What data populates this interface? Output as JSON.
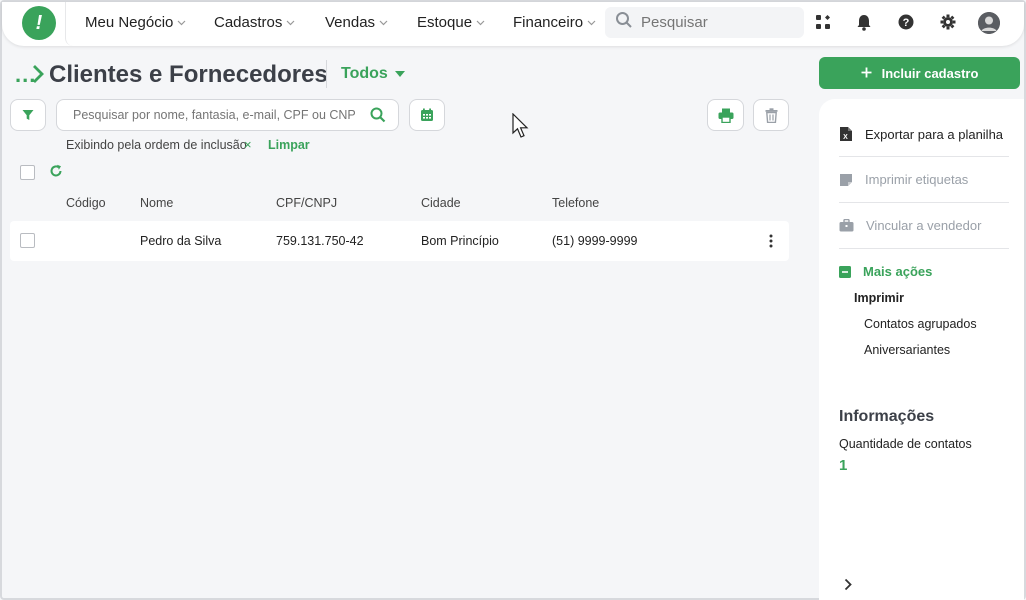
{
  "logo": {
    "glyph": "!"
  },
  "nav": [
    {
      "label": "Meu Negócio"
    },
    {
      "label": "Cadastros"
    },
    {
      "label": "Vendas"
    },
    {
      "label": "Estoque"
    },
    {
      "label": "Financeiro"
    }
  ],
  "top_search": {
    "placeholder": "Pesquisar"
  },
  "header": {
    "breadcrumb": "...",
    "title": "Clientes e Fornecedores",
    "filter": "Todos"
  },
  "search": {
    "placeholder": "Pesquisar por nome, fantasia, e-mail, CPF ou CNPJ"
  },
  "order": {
    "text": "Exibindo pela ordem de inclusão",
    "clear_icon": "×",
    "clear": "Limpar"
  },
  "table": {
    "columns": [
      "Código",
      "Nome",
      "CPF/CNPJ",
      "Cidade",
      "Telefone"
    ],
    "rows": [
      {
        "codigo": "",
        "nome": "Pedro da Silva",
        "cpf": "759.131.750-42",
        "cidade": "Bom Princípio",
        "telefone": "(51) 9999-9999"
      }
    ]
  },
  "actions": {
    "add": "Incluir cadastro",
    "export": "Exportar para a planilha",
    "labels": "Imprimir etiquetas",
    "link_seller": "Vincular a vendedor",
    "more": "Mais ações",
    "print_header": "Imprimir",
    "grouped": "Contatos agrupados",
    "birthdays": "Aniversariantes"
  },
  "info": {
    "title": "Informações",
    "label": "Quantidade de contatos",
    "value": "1"
  },
  "colors": {
    "accent": "#3aa35b",
    "disabled": "#9aa0a8"
  }
}
